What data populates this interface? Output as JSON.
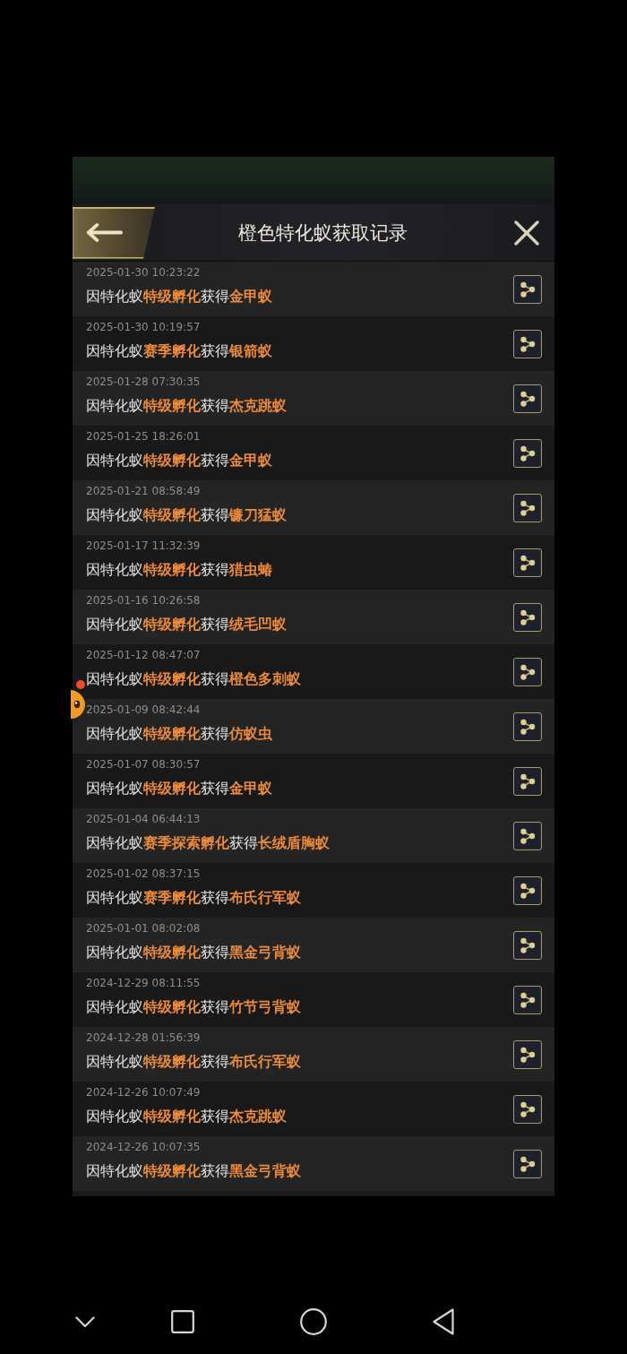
{
  "header": {
    "title": "橙色特化蚁获取记录"
  },
  "records": [
    {
      "time": "2025-01-30 10:23:22",
      "text": "因特化蚁**特级孵化**获得**金甲蚁**"
    },
    {
      "time": "2025-01-30 10:19:57",
      "text": "因特化蚁**赛季孵化**获得**银箭蚁**"
    },
    {
      "time": "2025-01-28 07:30:35",
      "text": "因特化蚁**特级孵化**获得**杰克跳蚁**"
    },
    {
      "time": "2025-01-25 18:26:01",
      "text": "因特化蚁**特级孵化**获得**金甲蚁**"
    },
    {
      "time": "2025-01-21 08:58:49",
      "text": "因特化蚁**特级孵化**获得**镰刀猛蚁**"
    },
    {
      "time": "2025-01-17 11:32:39",
      "text": "因特化蚁**特级孵化**获得**猎虫蝽**"
    },
    {
      "time": "2025-01-16 10:26:58",
      "text": "因特化蚁**特级孵化**获得**绒毛凹蚁**"
    },
    {
      "time": "2025-01-12 08:47:07",
      "text": "因特化蚁**特级孵化**获得**橙色多刺蚁**"
    },
    {
      "time": "2025-01-09 08:42:44",
      "text": "因特化蚁**特级孵化**获得**仿蚁虫**"
    },
    {
      "time": "2025-01-07 08:30:57",
      "text": "因特化蚁**特级孵化**获得**金甲蚁**"
    },
    {
      "time": "2025-01-04 06:44:13",
      "text": "因特化蚁**赛季探索孵化**获得**长绒盾胸蚁**"
    },
    {
      "time": "2025-01-02 08:37:15",
      "text": "因特化蚁**赛季孵化**获得**布氏行军蚁**"
    },
    {
      "time": "2025-01-01 08:02:08",
      "text": "因特化蚁**特级孵化**获得**黑金弓背蚁**"
    },
    {
      "time": "2024-12-29 08:11:55",
      "text": "因特化蚁**特级孵化**获得**竹节弓背蚁**"
    },
    {
      "time": "2024-12-28 01:56:39",
      "text": "因特化蚁**特级孵化**获得**布氏行军蚁**"
    },
    {
      "time": "2024-12-26 10:07:49",
      "text": "因特化蚁**特级孵化**获得**杰克跳蚁**"
    },
    {
      "time": "2024-12-26 10:07:35",
      "text": "因特化蚁**特级孵化**获得**黑金弓背蚁**"
    }
  ]
}
